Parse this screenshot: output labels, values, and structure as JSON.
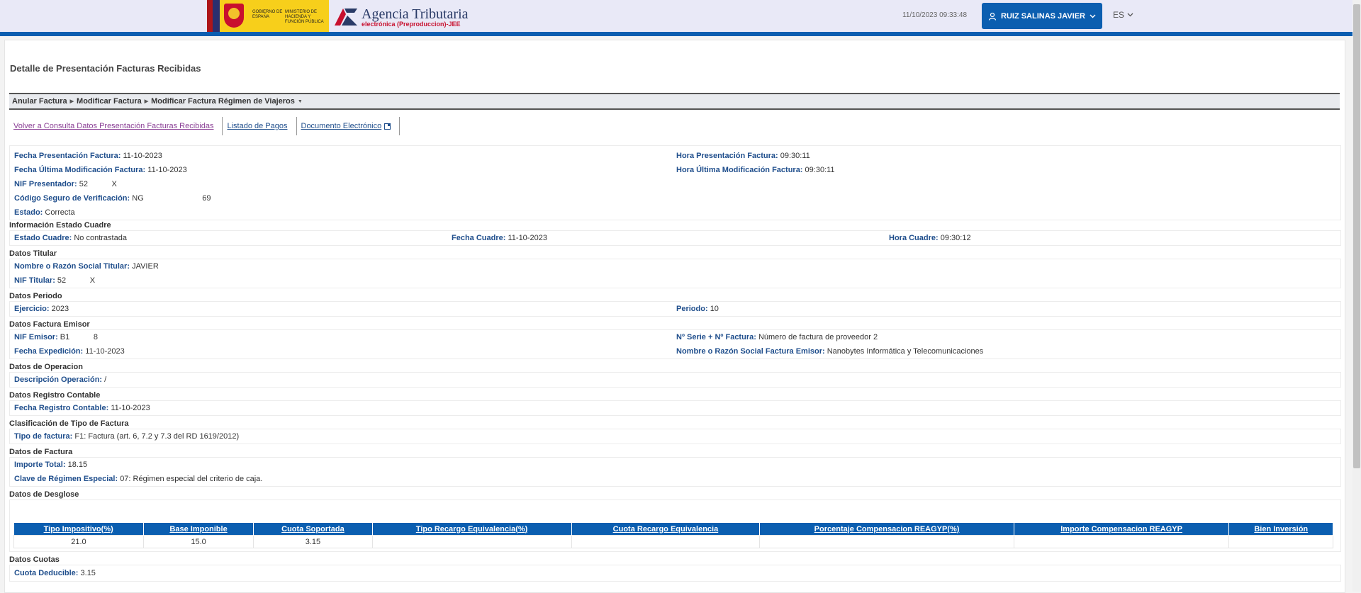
{
  "header": {
    "gov_text": "Gobierno de España",
    "ministry_text": "Ministerio de Hacienda y Función Pública",
    "agency_title": "Agencia Tributaria",
    "agency_subtitle": "electrónica (Preproduccion)-JEE",
    "datetime": "11/10/2023 09:33:48",
    "user_name": "RUIZ SALINAS JAVIER",
    "language": "ES",
    "accent_color": "#0b5eb0"
  },
  "page": {
    "title": "Detalle de Presentación Facturas Recibidas"
  },
  "actions": [
    {
      "label": "Anular Factura"
    },
    {
      "label": "Modificar Factura"
    },
    {
      "label": "Modificar Factura Régimen de Viajeros"
    }
  ],
  "links": {
    "back": "Volver a Consulta Datos Presentación Facturas Recibidas",
    "payments": "Listado de Pagos",
    "document": "Documento Electrónico"
  },
  "general": {
    "fecha_presentacion_label": "Fecha Presentación Factura:",
    "fecha_presentacion_value": "11-10-2023",
    "hora_presentacion_label": "Hora Presentación Factura:",
    "hora_presentacion_value": "09:30:11",
    "fecha_modificacion_label": "Fecha Última Modificación Factura:",
    "fecha_modificacion_value": "11-10-2023",
    "hora_modificacion_label": "Hora Última Modificación Factura:",
    "hora_modificacion_value": "09:30:11",
    "nif_presentador_label": "NIF Presentador:",
    "nif_presentador_value": "52           X",
    "csv_label": "Código Seguro de Verificación:",
    "csv_value": "NG                           69",
    "estado_label": "Estado:",
    "estado_value": "Correcta"
  },
  "estado_cuadre": {
    "title": "Información Estado Cuadre",
    "estado_label": "Estado Cuadre:",
    "estado_value": "No contrastada",
    "fecha_label": "Fecha Cuadre:",
    "fecha_value": "11-10-2023",
    "hora_label": "Hora Cuadre:",
    "hora_value": "09:30:12"
  },
  "titular": {
    "title": "Datos Titular",
    "nombre_label": "Nombre o Razón Social Titular:",
    "nombre_value": "JAVIER",
    "nif_label": "NIF Titular:",
    "nif_value": "52           X"
  },
  "periodo": {
    "title": "Datos Periodo",
    "ejercicio_label": "Ejercicio:",
    "ejercicio_value": "2023",
    "periodo_label": "Periodo:",
    "periodo_value": "10"
  },
  "emisor": {
    "title": "Datos Factura Emisor",
    "nif_label": "NIF Emisor:",
    "nif_value": "B1           8",
    "serie_label": "Nº Serie + Nº Factura:",
    "serie_value": "Número de factura de proveedor 2",
    "fecha_label": "Fecha Expedición:",
    "fecha_value": "11-10-2023",
    "nombre_label": "Nombre o Razón Social Factura Emisor:",
    "nombre_value": "Nanobytes Informática y Telecomunicaciones"
  },
  "operacion": {
    "title": "Datos de Operacion",
    "descripcion_label": "Descripción Operación:",
    "descripcion_value": "/"
  },
  "registro": {
    "title": "Datos Registro Contable",
    "fecha_label": "Fecha Registro Contable:",
    "fecha_value": "11-10-2023"
  },
  "clasificacion": {
    "title": "Clasificación de Tipo de Factura",
    "tipo_label": "Tipo de factura:",
    "tipo_value": "F1: Factura (art. 6, 7.2 y 7.3 del RD 1619/2012)"
  },
  "factura": {
    "title": "Datos de Factura",
    "importe_label": "Importe Total:",
    "importe_value": "18.15",
    "clave_label": "Clave de Régimen Especial:",
    "clave_value": "07: Régimen especial del criterio de caja."
  },
  "desglose": {
    "title": "Datos de Desglose",
    "headers": [
      "Tipo Impositivo(%)",
      "Base Imponible",
      "Cuota Soportada",
      "Tipo Recargo Equivalencia(%)",
      "Cuota Recargo Equivalencia",
      "Porcentaje Compensacion REAGYP(%)",
      "Importe Compensacion REAGYP",
      "Bien Inversión"
    ],
    "rows": [
      [
        "21.0",
        "15.0",
        "3.15",
        "",
        "",
        "",
        "",
        ""
      ]
    ]
  },
  "cuotas": {
    "title": "Datos Cuotas",
    "deducible_label": "Cuota Deducible:",
    "deducible_value": "3.15"
  }
}
